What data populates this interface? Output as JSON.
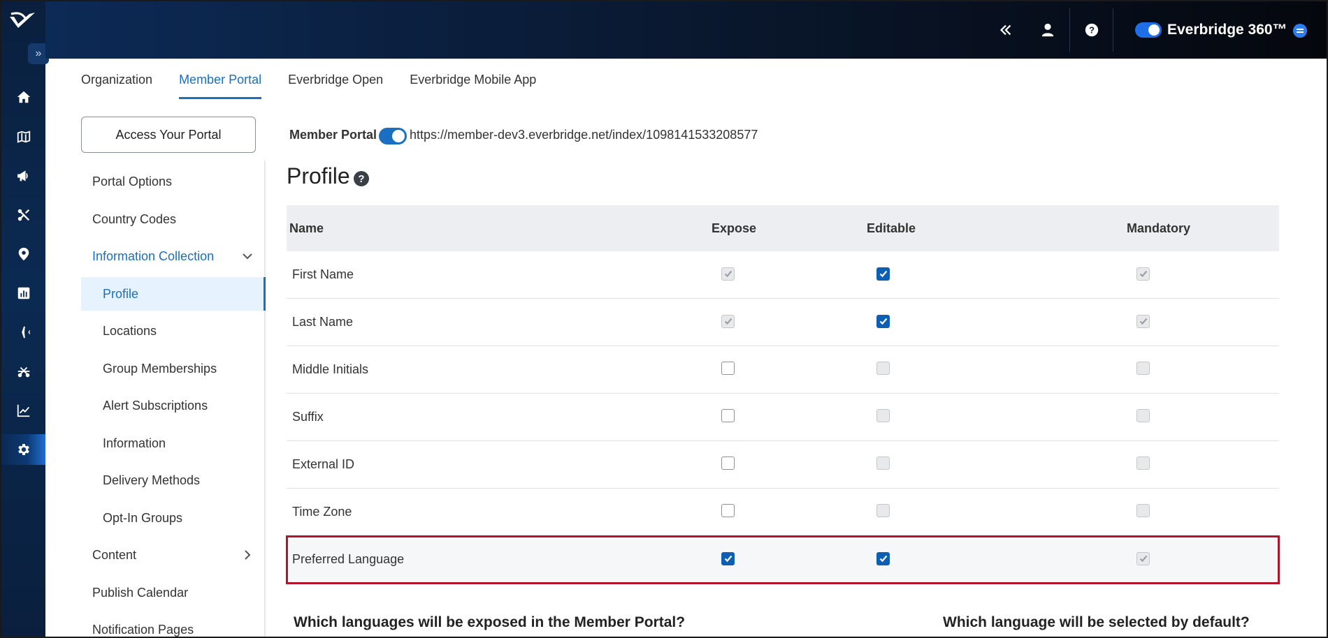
{
  "app": {
    "brand": "Everbridge 360™"
  },
  "rail": {
    "items": [
      {
        "icon": "home-icon"
      },
      {
        "icon": "map-icon"
      },
      {
        "icon": "megaphone-icon"
      },
      {
        "icon": "incident-icon"
      },
      {
        "icon": "location-pin-icon"
      },
      {
        "icon": "report-icon"
      },
      {
        "icon": "plane-icon"
      },
      {
        "icon": "scissors-icon"
      },
      {
        "icon": "chart-icon"
      },
      {
        "icon": "gear-icon",
        "active": true
      }
    ]
  },
  "tabs": [
    {
      "label": "Organization"
    },
    {
      "label": "Member Portal",
      "active": true
    },
    {
      "label": "Everbridge Open"
    },
    {
      "label": "Everbridge Mobile App"
    }
  ],
  "sidebar": {
    "access_button": "Access Your Portal",
    "items": [
      {
        "label": "Portal Options"
      },
      {
        "label": "Country Codes"
      },
      {
        "label": "Information Collection"
      },
      {
        "label": "Profile"
      },
      {
        "label": "Locations"
      },
      {
        "label": "Group Memberships"
      },
      {
        "label": "Alert Subscriptions"
      },
      {
        "label": "Information"
      },
      {
        "label": "Delivery Methods"
      },
      {
        "label": "Opt-In Groups"
      },
      {
        "label": "Content"
      },
      {
        "label": "Publish Calendar"
      },
      {
        "label": "Notification Pages"
      }
    ]
  },
  "main": {
    "portal_label": "Member Portal",
    "portal_url": "https://member-dev3.everbridge.net/index/1098141533208577",
    "title": "Profile",
    "help": "?",
    "table": {
      "headers": {
        "name": "Name",
        "expose": "Expose",
        "editable": "Editable",
        "mandatory": "Mandatory"
      },
      "rows": [
        {
          "name": "First Name",
          "expose": "checked-disabled",
          "editable": "checked",
          "mandatory": "checked-disabled"
        },
        {
          "name": "Last Name",
          "expose": "checked-disabled",
          "editable": "checked",
          "mandatory": "checked-disabled"
        },
        {
          "name": "Middle Initials",
          "expose": "unchecked",
          "editable": "unchecked-disabled",
          "mandatory": "unchecked-disabled"
        },
        {
          "name": "Suffix",
          "expose": "unchecked",
          "editable": "unchecked-disabled",
          "mandatory": "unchecked-disabled"
        },
        {
          "name": "External ID",
          "expose": "unchecked",
          "editable": "unchecked-disabled",
          "mandatory": "unchecked-disabled"
        },
        {
          "name": "Time Zone",
          "expose": "unchecked",
          "editable": "unchecked-disabled",
          "mandatory": "unchecked-disabled"
        },
        {
          "name": "Preferred Language",
          "expose": "checked",
          "editable": "checked",
          "mandatory": "checked-disabled",
          "highlighted": true
        }
      ]
    },
    "question_languages": "Which languages will be exposed in the Member Portal?",
    "question_default": "Which language will be selected by default?"
  }
}
